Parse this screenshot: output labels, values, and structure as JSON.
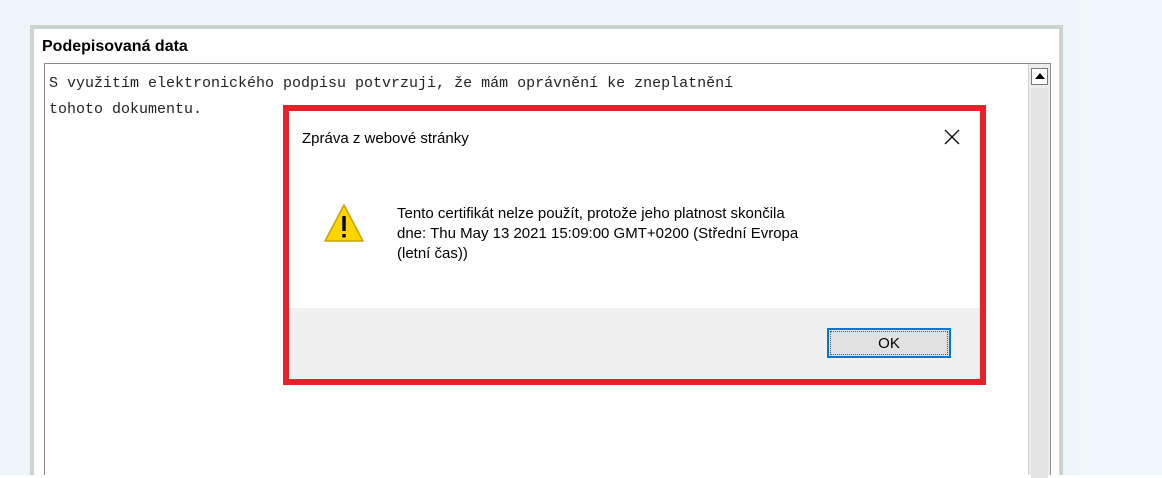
{
  "section": {
    "title": "Podepisovaná data"
  },
  "document_text": "S využitím elektronického podpisu potvrzuji, že mám oprávnění ke zneplatnění\ntohoto dokumentu.",
  "dialog": {
    "title": "Zpráva z webové stránky",
    "message_lines": [
      "Tento certifikát nelze použít, protože jeho platnost skončila",
      "dne: Thu May 13 2021 15:09:00 GMT+0200 (Střední Evropa",
      "(letní čas))"
    ],
    "ok_label": "OK",
    "icon": "warning-icon",
    "close_icon": "close-icon"
  },
  "colors": {
    "highlight_border": "#e8202a",
    "ok_border": "#0078d7",
    "warning_fill": "#ffd400"
  }
}
